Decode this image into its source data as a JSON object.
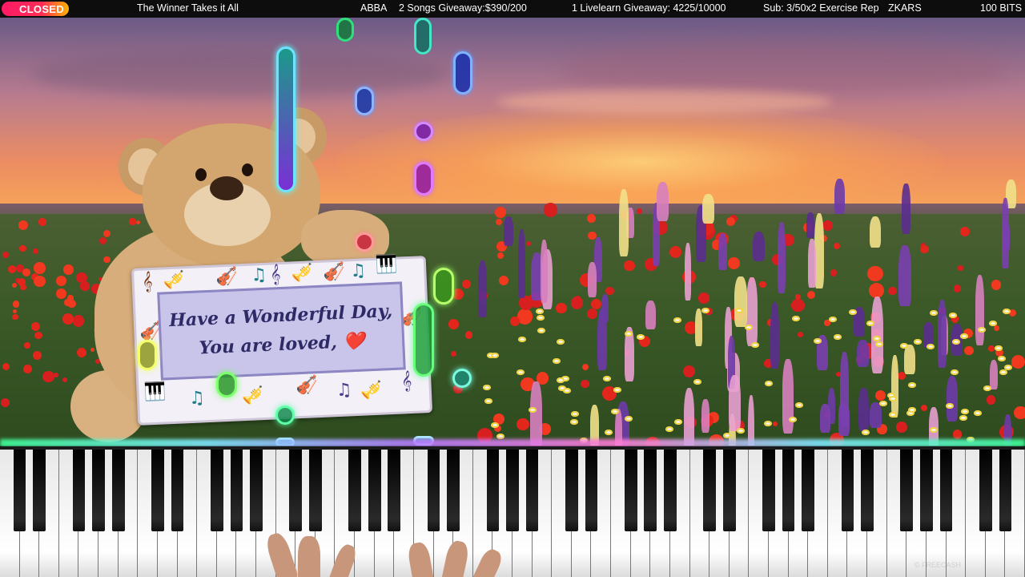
{
  "ticker": {
    "status_badge": "CLOSED",
    "song_title": "The Winner Takes it All",
    "artist": "ABBA",
    "songs_giveaway": "2 Songs Giveaway:$390/200",
    "livelearn_giveaway": "1 Livelearn Giveaway: 4225/10000",
    "sub_exercise": "Sub: 3/50x2 Exercise Rep",
    "viewer": "ZKARS",
    "bits": "100 BITS"
  },
  "sign": {
    "line1": "Have a Wonderful Day,",
    "line2": "You are loved, ❤️"
  },
  "watermark": "© FREECASH",
  "colors": {
    "badge_start": "#ff1a66",
    "badge_end": "#ffb400",
    "note_blue": "#2c6cff",
    "note_purple": "#b33dff",
    "note_green": "#35e06b",
    "note_teal": "#2fd0c0"
  },
  "icons": {
    "treble_clef": "treble-clef-icon",
    "violin": "violin-icon",
    "trumpet": "trumpet-icon",
    "grand_piano": "grand-piano-icon",
    "music_note": "music-note-icon",
    "heart": "heart-icon"
  }
}
